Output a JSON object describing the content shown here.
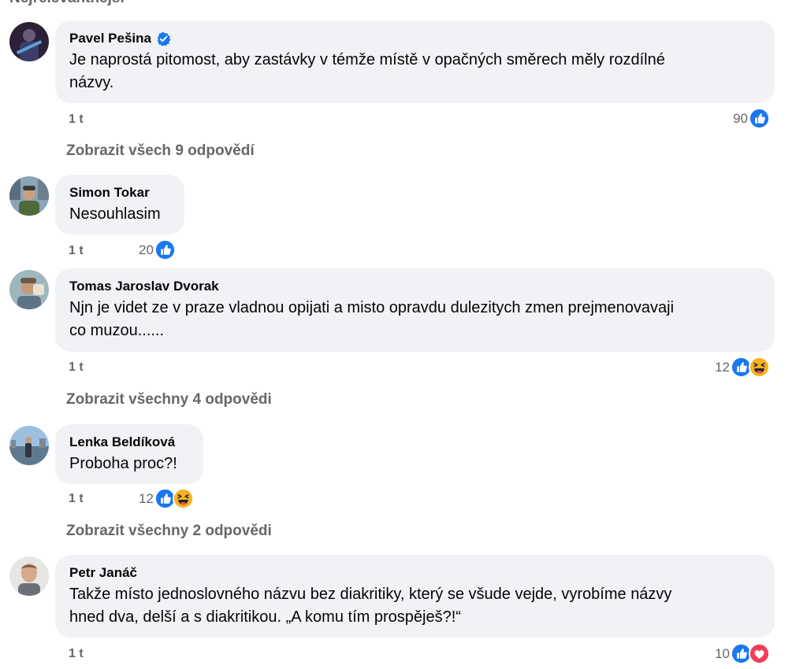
{
  "section_label": "Nejrelevantnější",
  "comments": [
    {
      "author": "Pavel Pešina",
      "verified": true,
      "text_line1": "Je naprostá pitomost, aby zastávky v témže místě v opačných směrech měly rozdílné",
      "text_line2": "názvy.",
      "time": "1 t",
      "reaction_count": "90",
      "reactions": [
        "like-icon"
      ],
      "replies_label": "Zobrazit všech 9 odpovědí"
    },
    {
      "author": "Simon Tokar",
      "text_line1": "Nesouhlasim",
      "time": "1 t",
      "reaction_count": "20",
      "reactions": [
        "like-icon"
      ]
    },
    {
      "author": "Tomas Jaroslav Dvorak",
      "text_line1": "Njn je videt ze v praze vladnou opijati a misto opravdu dulezitych zmen prejmenovavaji",
      "text_line2": "co muzou......",
      "time": "1 t",
      "reaction_count": "12",
      "reactions": [
        "like-icon",
        "haha-icon"
      ],
      "replies_label": "Zobrazit všechny 4 odpovědi"
    },
    {
      "author": "Lenka Beldíková",
      "text_line1": "Proboha proc?!",
      "time": "1 t",
      "reaction_count": "12",
      "reactions": [
        "like-icon",
        "haha-icon"
      ],
      "replies_label": "Zobrazit všechny 2 odpovědi"
    },
    {
      "author": "Petr Janáč",
      "text_line1": "Takže místo jednoslovného názvu bez diakritiky, který se všude vejde, vyrobíme názvy",
      "text_line2": "hned dva, delší a s diakritikou. „A komu tím prospěješ?!“",
      "time": "1 t",
      "reaction_count": "10",
      "reactions": [
        "like-icon",
        "love-icon"
      ]
    }
  ],
  "colors": {
    "bubble": "#f0f2f5",
    "meta_text": "#65676b",
    "like_blue": "#1877f2",
    "haha_yellow": "#f7b125",
    "love_red": "#f33e58"
  }
}
